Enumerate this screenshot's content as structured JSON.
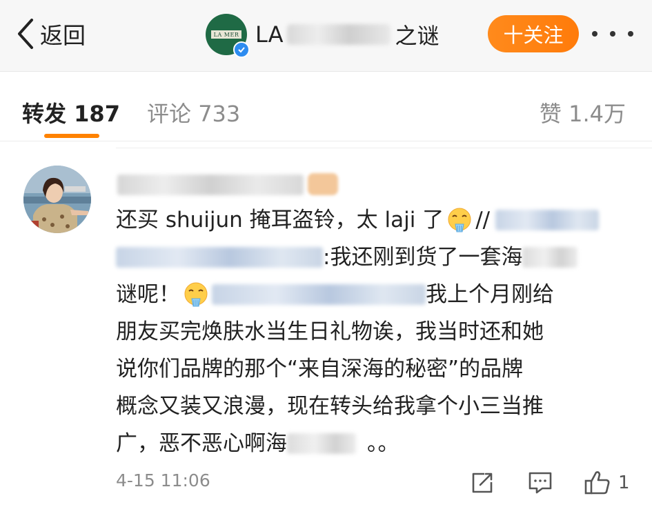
{
  "header": {
    "back_label": "返回",
    "account_name_prefix": "LA",
    "account_name_suffix": "之谜",
    "logo_text": "LA MER",
    "follow_label": "十关注",
    "colors": {
      "follow": "#ff8200",
      "verified": "#2d8cf0",
      "logo": "#1f6a45"
    }
  },
  "tabs": {
    "repost": {
      "label": "转发",
      "count": "187",
      "active": true
    },
    "comment": {
      "label": "评论",
      "count": "733"
    },
    "like": {
      "label": "赞",
      "count": "1.4万"
    }
  },
  "comment": {
    "line1_text": "还买 shuijun 掩耳盗铃，太 laji 了",
    "line1_sep": "//",
    "line2_text": ":我还刚到货了一套海",
    "line3_start": "谜呢！",
    "line3_end": "我上个月刚给",
    "line4": "朋友买完焕肤水当生日礼物诶，我当时还和她",
    "line5": "说你们品牌的那个“来自深海的秘密”的品牌",
    "line6": "概念又装又浪漫，现在转头给我拿个小三当推",
    "line7_start": "广，恶不恶心啊海",
    "line7_end": "。。",
    "timestamp": "4-15 11:06",
    "like_count": "1",
    "icons": [
      "face-with-steam-emoji",
      "repost-icon",
      "comment-icon",
      "thumbs-up-icon"
    ]
  }
}
